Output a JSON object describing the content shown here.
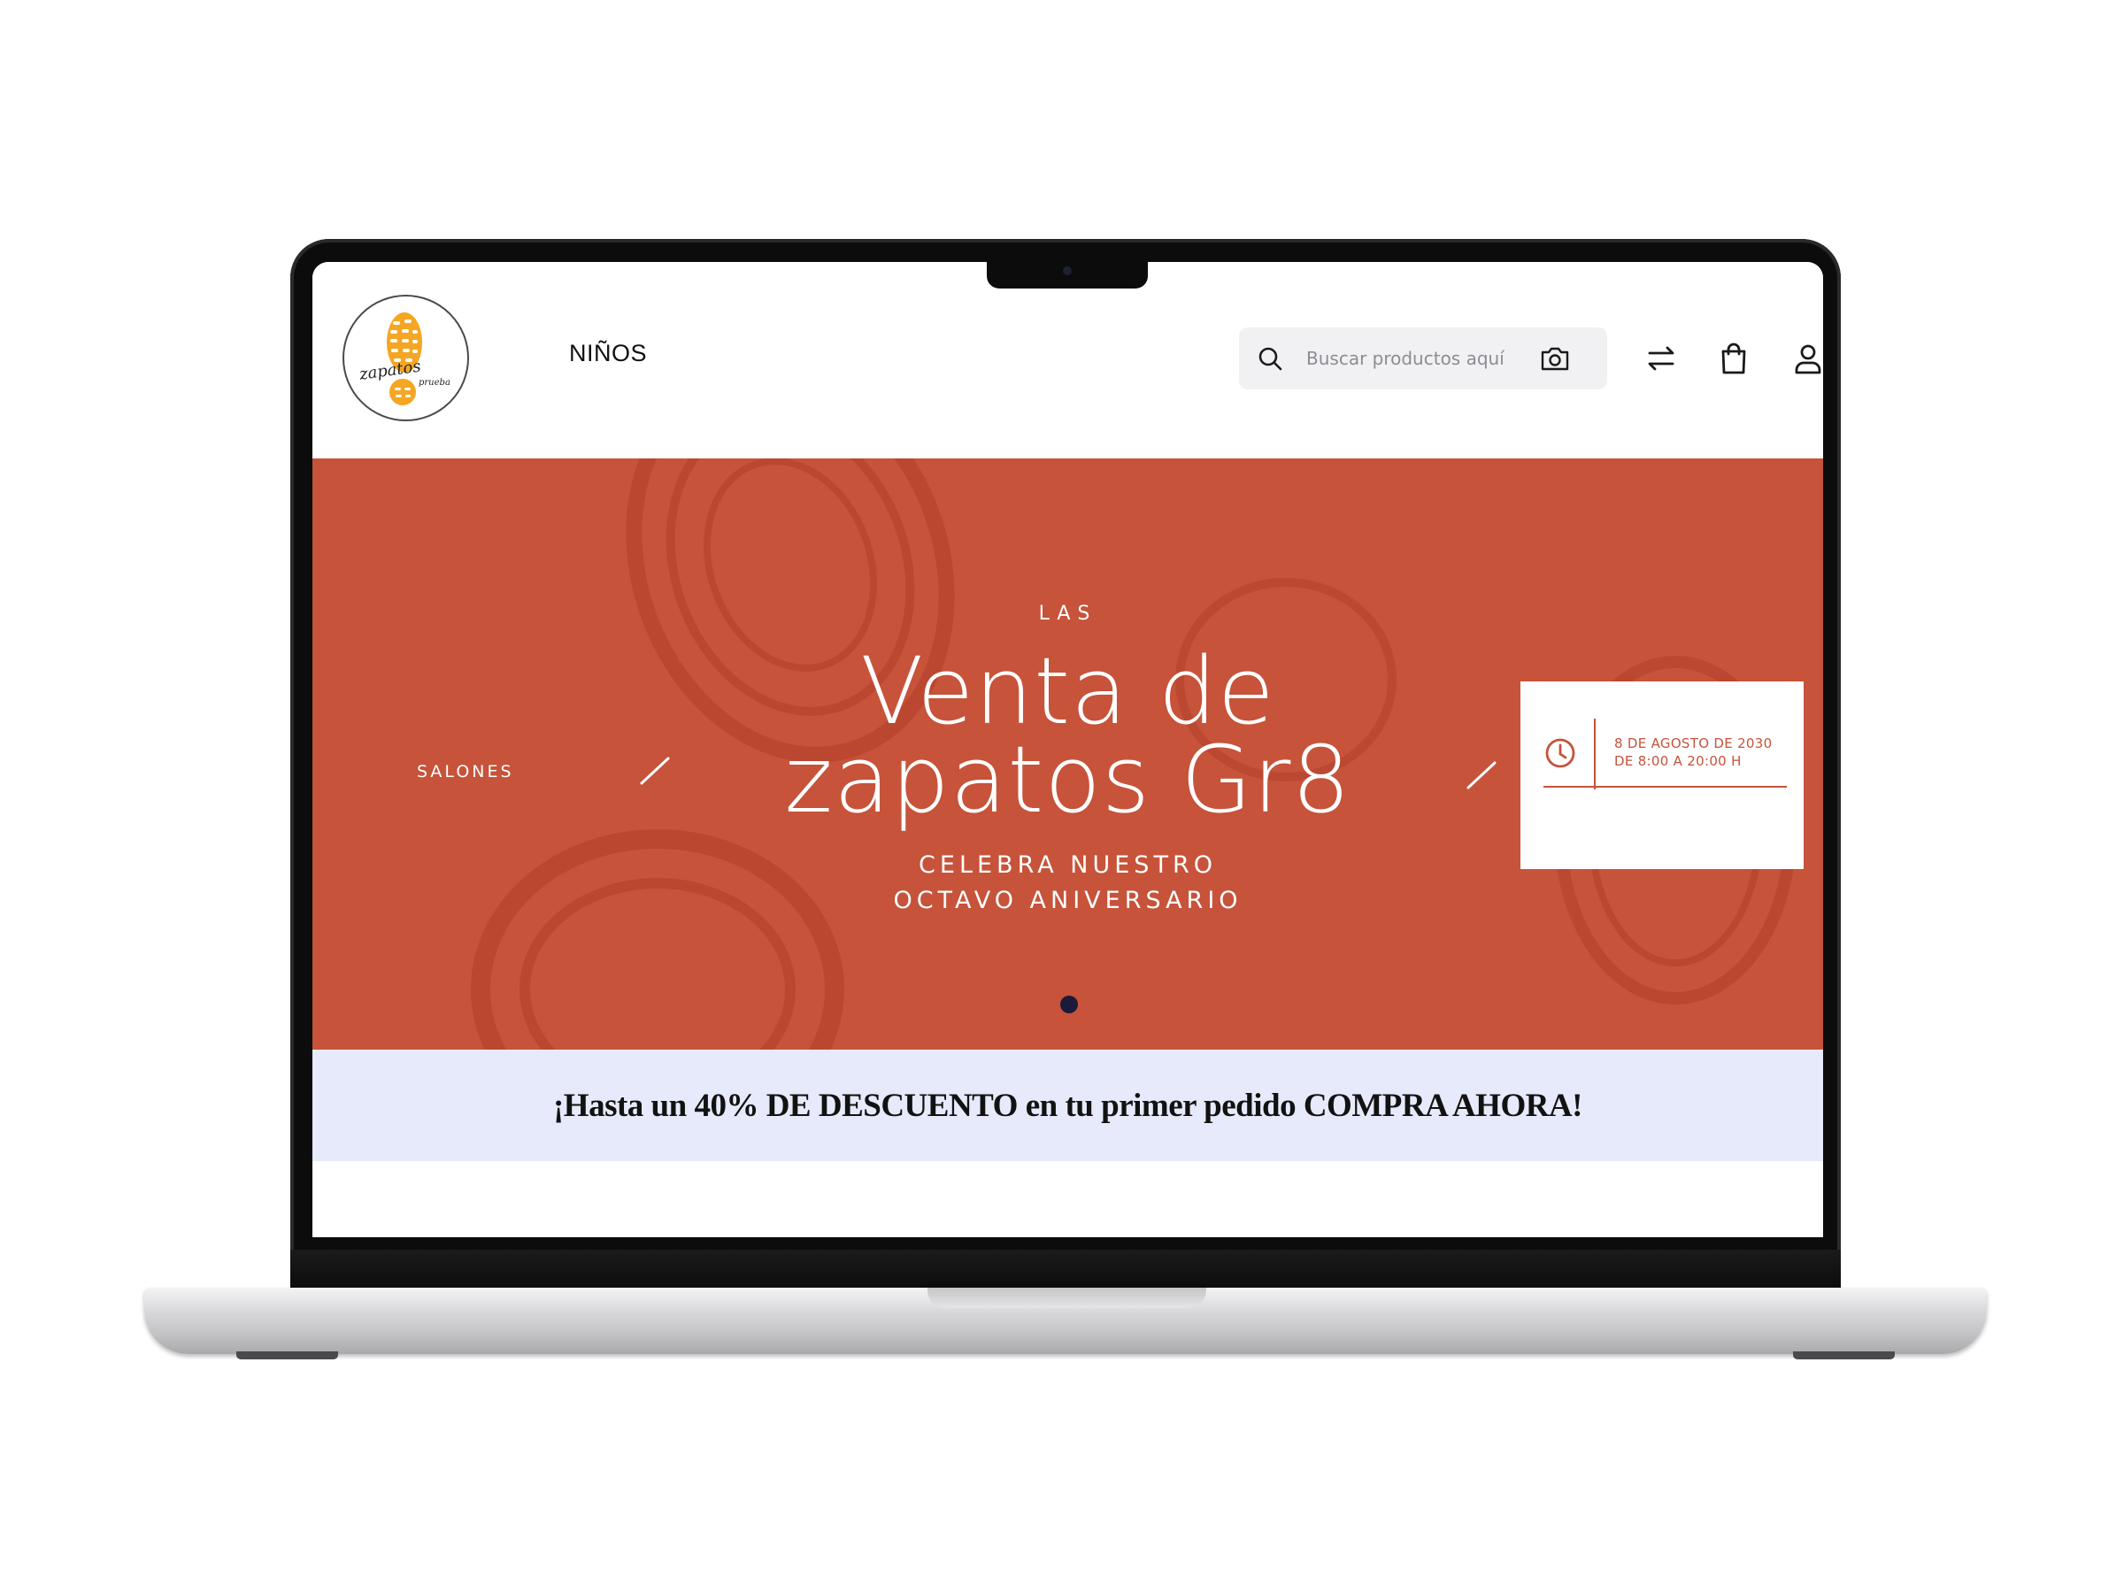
{
  "header": {
    "logo_text": "zapatos",
    "logo_subtext": "prueba",
    "nav": [
      "NIÑOS"
    ],
    "search": {
      "placeholder": "Buscar productos aquí"
    },
    "icons": [
      "search-icon",
      "camera-icon",
      "compare-arrows-icon",
      "shopping-bag-icon",
      "user-icon"
    ]
  },
  "hero": {
    "kicker": "LAS",
    "title_line1": "Venta de",
    "title_line2": "zapatos Gr8",
    "subtitle_line1": "CELEBRA NUESTRO",
    "subtitle_line2": "OCTAVO ANIVERSARIO",
    "side_label": "SALONES",
    "event": {
      "date": "8 DE AGOSTO DE 2030",
      "time": "DE 8:00 A 20:00 H"
    },
    "slide_count": 1,
    "active_slide": 1
  },
  "promo": {
    "text": "¡Hasta un 40% DE DESCUENTO en tu primer pedido COMPRA AHORA!"
  },
  "colors": {
    "hero_bg": "#c6533a",
    "promo_bg": "#e6eafb",
    "logo_accent": "#f5a623",
    "dot": "#1b1a3a"
  }
}
